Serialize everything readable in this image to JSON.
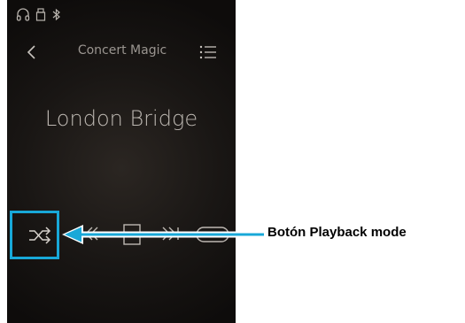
{
  "app": {
    "status_icons": [
      "headphones-icon",
      "usb-icon",
      "bluetooth-icon"
    ],
    "header": {
      "back_icon": "chevron-left-icon",
      "title": "Concert Magic",
      "menu_icon": "list-icon"
    },
    "song_title": "London Bridge",
    "controls": [
      "shuffle-icon",
      "previous-icon",
      "stop-icon",
      "next-icon",
      "loop-icon"
    ]
  },
  "callout": {
    "label": "Botón Playback mode",
    "color": "#18a8d8"
  }
}
